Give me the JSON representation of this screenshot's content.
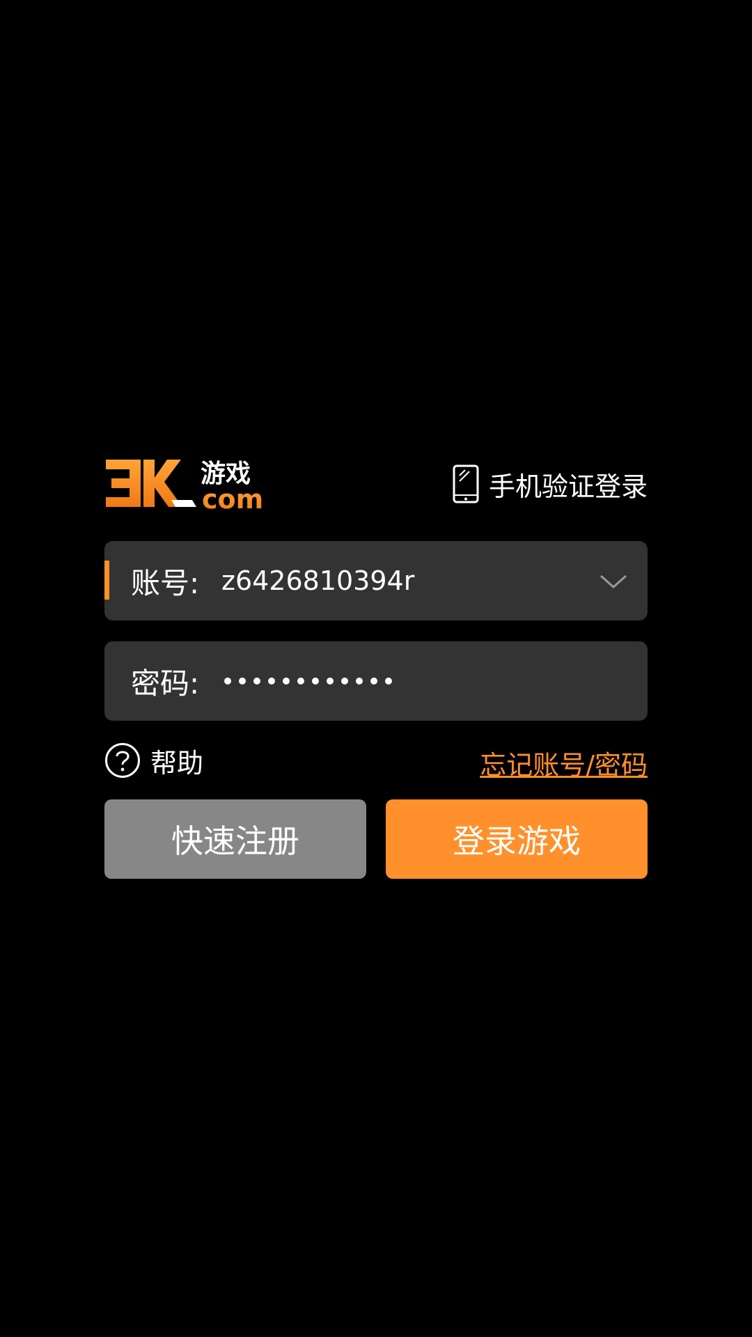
{
  "header": {
    "logo_text": "3K游戏 com",
    "phone_login_label": "手机验证登录"
  },
  "account_field": {
    "label": "账号:",
    "value": "z6426810394r"
  },
  "password_field": {
    "label": "密码:",
    "masked_length": 12
  },
  "links": {
    "help_label": "帮助",
    "forgot_label": "忘记账号/密码"
  },
  "buttons": {
    "register_label": "快速注册",
    "login_label": "登录游戏"
  },
  "icons": {
    "phone": "phone-icon",
    "dropdown": "chevron-down-icon",
    "help": "question-circle-icon"
  },
  "colors": {
    "background": "#000000",
    "field_bg": "#333333",
    "accent": "#ff8f27",
    "register_btn": "#878787",
    "login_btn": "#ff902b"
  }
}
